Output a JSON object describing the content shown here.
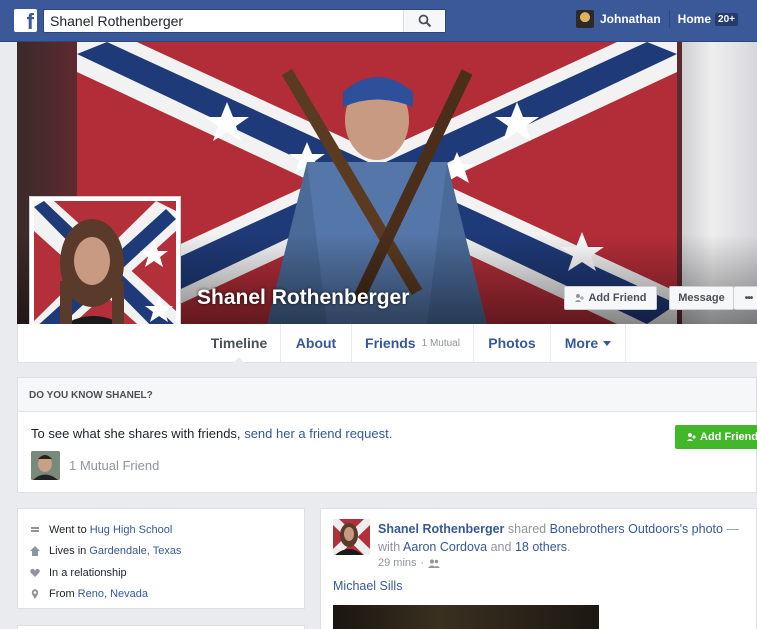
{
  "topbar": {
    "search_value": "Shanel Rothenberger",
    "user_name": "Johnathan",
    "home_label": "Home",
    "notif_badge": "20+"
  },
  "profile": {
    "name": "Shanel Rothenberger",
    "add_friend_label": "Add Friend",
    "message_label": "Message",
    "more_dots": "•••"
  },
  "tabs": [
    {
      "label": "Timeline"
    },
    {
      "label": "About"
    },
    {
      "label": "Friends",
      "sub": "1 Mutual"
    },
    {
      "label": "Photos"
    },
    {
      "label": "More"
    }
  ],
  "know_box": {
    "heading": "DO YOU KNOW SHANEL?",
    "text_prefix": "To see what she shares with friends,",
    "text_link": "send her a friend request.",
    "add_friend_label": "Add Friend",
    "mutual_label": "1 Mutual Friend"
  },
  "intro": [
    {
      "icon": "school-icon",
      "prefix": "Went to",
      "link": "Hug High School"
    },
    {
      "icon": "home-icon",
      "prefix": "Lives in",
      "link": "Gardendale, Texas"
    },
    {
      "icon": "heart-icon",
      "prefix": "In a relationship",
      "link": ""
    },
    {
      "icon": "location-pin-icon",
      "prefix": "From",
      "link": "Reno, Nevada"
    }
  ],
  "post": {
    "author": "Shanel Rothenberger",
    "shared_text": "shared",
    "source": "Bonebrothers Outdoors's photo",
    "dash": "—",
    "with_text": "with",
    "tagged": "Aaron Cordova",
    "and_text": "and",
    "others": "18 others",
    "period": ".",
    "time": "29 mins",
    "dot": "·",
    "body": "Michael Sills"
  },
  "colors": {
    "brand": "#3b5998",
    "link": "#365899",
    "green": "#42b72a"
  }
}
